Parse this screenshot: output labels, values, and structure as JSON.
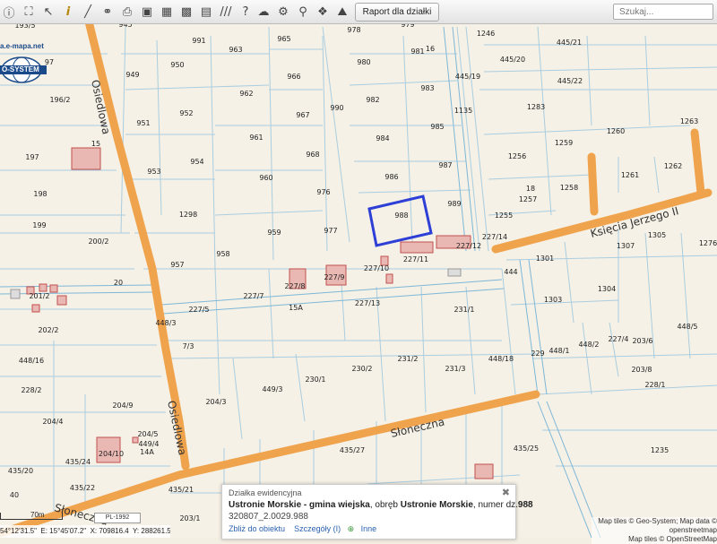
{
  "toolbar": {
    "icons": [
      "info-icon",
      "fullscreen-icon",
      "select-arrow-icon",
      "info-italic-icon",
      "measure-line-icon",
      "link-icon",
      "print-icon",
      "gallery-icon",
      "window-icon",
      "hatch-icon",
      "help-icon",
      "cloud-icon",
      "settings-icon",
      "zoom-search-icon",
      "sail-icon"
    ],
    "report_button": "Raport dla działki",
    "search_placeholder": "Szukaj..."
  },
  "logo": {
    "url_text": "a.e-mapa.net",
    "brand": "O-SYSTEM"
  },
  "map": {
    "roads": [
      "Osiedlowa",
      "Słoneczna",
      "Księcia Jerzego II",
      "Osiedlowa",
      "Słoneczna"
    ],
    "plots": [
      "945",
      "979",
      "193/5",
      "991",
      "965",
      "978",
      "1246",
      "445/21",
      "97",
      "963",
      "980",
      "981",
      "445/20",
      "966",
      "445/19",
      "949",
      "950",
      "982",
      "983",
      "445/22",
      "196/2",
      "962",
      "990",
      "1135",
      "1283",
      "951",
      "952",
      "967",
      "1263",
      "961",
      "984",
      "985",
      "1259",
      "1260",
      "953",
      "954",
      "968",
      "197",
      "960",
      "986",
      "987",
      "1256",
      "1261",
      "1262",
      "1257",
      "1258",
      "198",
      "976",
      "988",
      "989",
      "1298",
      "1255",
      "199",
      "959",
      "977",
      "227/14",
      "1305",
      "1276",
      "958",
      "200/2",
      "227/11",
      "227/12",
      "1301",
      "1307",
      "957",
      "227/10",
      "444",
      "227/8",
      "227/9",
      "201/2",
      "227/7",
      "227/13",
      "1303",
      "1304",
      "227/5",
      "231/1",
      "202/2",
      "448/5",
      "448/3",
      "7/3",
      "227/4",
      "448/2",
      "448/1",
      "203/6",
      "448/16",
      "229",
      "230/1",
      "230/2",
      "231/2",
      "231/3",
      "448/18",
      "203/8",
      "228/2",
      "449/3",
      "228/1",
      "204/3",
      "204/9",
      "435/27",
      "204/4",
      "204/5",
      "204/10",
      "449/4",
      "435/24",
      "1235",
      "435/25",
      "435/20",
      "435/22",
      "435/21",
      "435/23",
      "203/1",
      "19",
      "40",
      "15",
      "20",
      "14A",
      "15A",
      "16",
      "18"
    ]
  },
  "popup": {
    "header": "Działka ewidencyjna",
    "owner_text": "Ustronie Morskie - gmina wiejska",
    "mid_text": ", obręb ",
    "district": "Ustronie Morskie",
    "num_label": ", numer dz.",
    "parcel": "988",
    "id": "320807_2.0029.988",
    "zoom_link": "Zbliż do obiektu",
    "details_link": "Szczegóły (I)",
    "other_link": "Inne"
  },
  "scale": {
    "text": "70m",
    "projection": "PL-1992"
  },
  "coords": {
    "lat": "54°12'31.5\"",
    "lon": "E: 15°45'07.2\"",
    "x": "X: 709816.4",
    "y": "Y: 288261.5"
  },
  "attribution": {
    "line1": "Map tiles © Geo-System; Map data ©",
    "line2": "openstreetmap",
    "line3": "Map tiles © OpenStreetMap"
  },
  "colors": {
    "road": "#f0a34d",
    "parcel_line": "#9dc8df",
    "selection": "#2d3fd6",
    "building": "#e9b3ad",
    "background": "#f6f1e6"
  }
}
